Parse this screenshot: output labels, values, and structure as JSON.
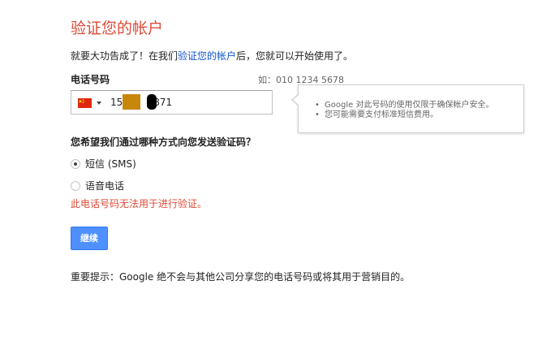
{
  "page": {
    "title": "验证您的帐户",
    "intro": {
      "before": "就要大功告成了！在我们",
      "link": "验证您的帐户",
      "after": "后，您就可以开始使用了。"
    },
    "phone": {
      "label": "电话号码",
      "example": "如：010 1234 5678",
      "country_flag": "china-flag",
      "value_prefix": "15",
      "value_suffix": "871"
    },
    "tooltip": {
      "items": [
        "Google 对此号码的使用仅限于确保帐户安全。",
        "您可能需要支付标准短信费用。"
      ]
    },
    "delivery": {
      "question": "您希望我们通过哪种方式向您发送验证码？",
      "options": [
        {
          "label": "短信 (SMS)",
          "checked": true
        },
        {
          "label": "语音电话",
          "checked": false
        }
      ],
      "error": "此电话号码无法用于进行验证。"
    },
    "continue_label": "继续",
    "notice": "重要提示：Google 绝不会与其他公司分享您的电话号码或将其用于营销目的。"
  },
  "colors": {
    "title": "#dd4b39",
    "link": "#1155cc",
    "button": "#4d90fe",
    "error": "#dd4b39"
  }
}
